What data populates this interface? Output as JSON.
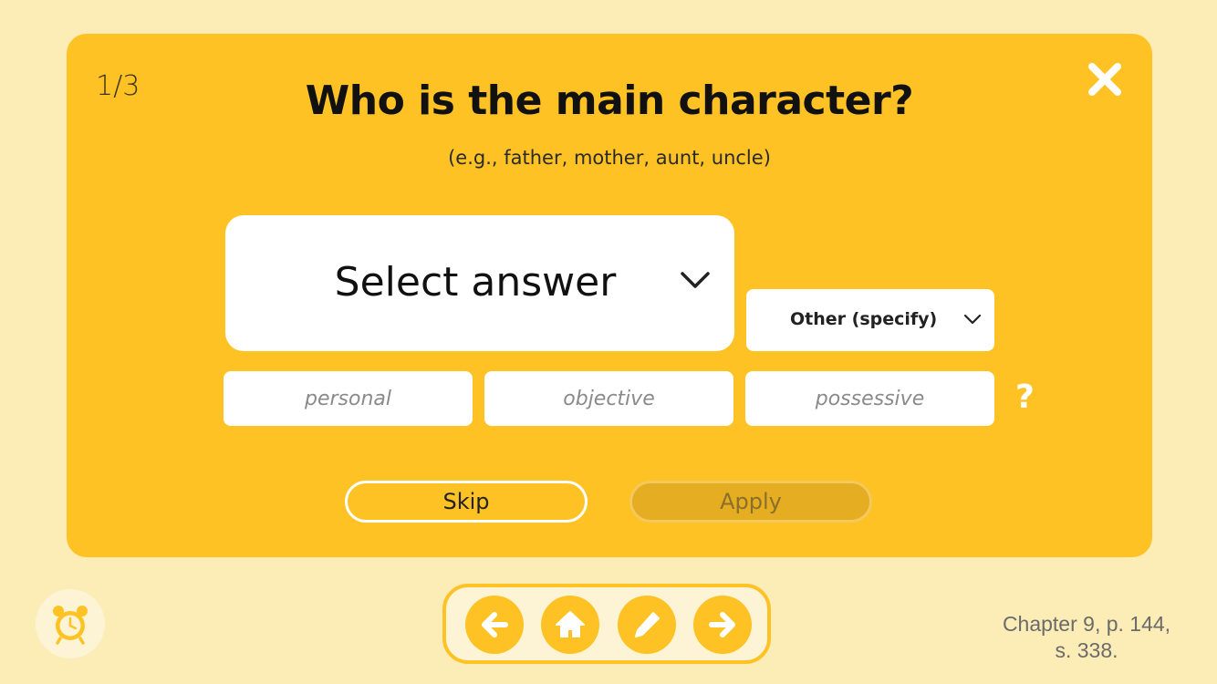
{
  "dialog": {
    "counter": "1/3",
    "question": "Who is the main character?",
    "hint": "(e.g., father, mother, aunt, uncle)",
    "main_select": {
      "value": "Select answer",
      "icon": "chevron-down-icon"
    },
    "other_select": {
      "value": "Other (specify)",
      "icon": "chevron-down-icon"
    },
    "fields": {
      "personal_placeholder": "personal",
      "objective_placeholder": "objective",
      "possessive_placeholder": "possessive"
    },
    "help_label": "?",
    "skip_label": "Skip",
    "apply_label": "Apply",
    "close_icon": "close-icon"
  },
  "footer": {
    "alarm_icon": "alarm-clock-icon",
    "nav": [
      {
        "name": "back",
        "icon": "arrow-left-icon"
      },
      {
        "name": "home",
        "icon": "home-icon"
      },
      {
        "name": "edit",
        "icon": "pencil-icon"
      },
      {
        "name": "forward",
        "icon": "arrow-right-icon"
      }
    ],
    "chapter_line1": "Chapter 9, p. 144,",
    "chapter_line2": "s. 338."
  },
  "colors": {
    "background": "#fcecb6",
    "card": "#fec224",
    "nav_panel": "#fdf4d6",
    "apply_disabled": "#e4ad22"
  }
}
